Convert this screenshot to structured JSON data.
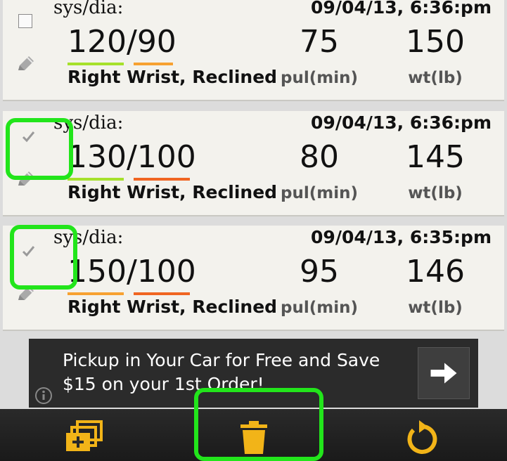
{
  "readings": [
    {
      "label": "sys/dia:",
      "timestamp": "09/04/13, 6:36:pm",
      "sys": "120",
      "dia": "90",
      "position": "Right Wrist, Reclined",
      "pulse": "75",
      "pulse_label": "pul(min)",
      "weight": "150",
      "weight_label": "wt(lb)",
      "checked": false,
      "sys_color": "#a6e12b",
      "dia_color": "#f7a131"
    },
    {
      "label": "sys/dia:",
      "timestamp": "09/04/13, 6:36:pm",
      "sys": "130",
      "dia": "100",
      "position": "Right Wrist, Reclined",
      "pulse": "80",
      "pulse_label": "pul(min)",
      "weight": "145",
      "weight_label": "wt(lb)",
      "checked": true,
      "sys_color": "#a6e12b",
      "dia_color": "#f06522"
    },
    {
      "label": "sys/dia:",
      "timestamp": "09/04/13, 6:35:pm",
      "sys": "150",
      "dia": "100",
      "position": "Right Wrist, Reclined",
      "pulse": "95",
      "pulse_label": "pul(min)",
      "weight": "146",
      "weight_label": "wt(lb)",
      "checked": true,
      "sys_color": "#f7a131",
      "dia_color": "#f06522"
    }
  ],
  "ad": {
    "text": "Pickup in Your Car for Free and Save $15 on your 1st Order!"
  },
  "toolbar": {
    "add_icon": "add-multiple-icon",
    "delete_icon": "trash-icon",
    "undo_icon": "undo-icon",
    "icon_color": "#f2b418"
  },
  "colors": {
    "highlight": "#22e51b",
    "card_bg": "#f3f2ed"
  }
}
